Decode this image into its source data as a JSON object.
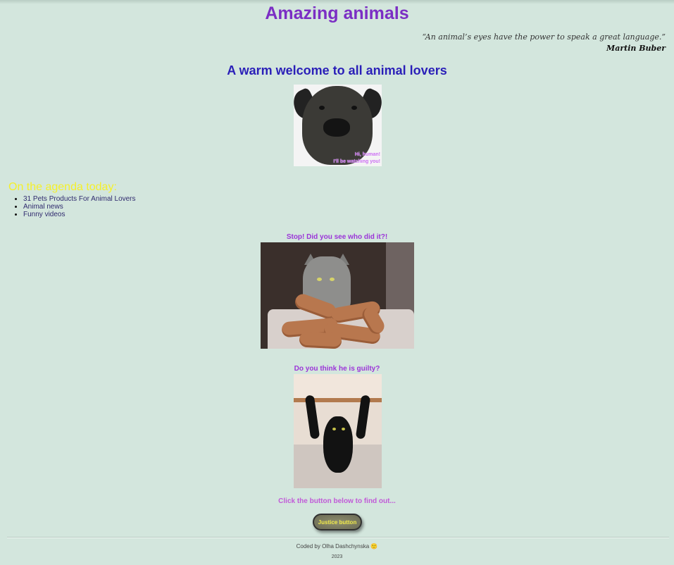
{
  "header": {
    "title": "Amazing animals",
    "quote_text": "“An animal’s eyes have the power to speak a great language.”",
    "quote_author": "Martin Buber"
  },
  "welcome": {
    "heading": "A warm welcome to all animal lovers",
    "photo_caption_line1": "Hi, human!",
    "photo_caption_line2": "I'll be watching you!"
  },
  "agenda": {
    "title": "On the agenda today:",
    "items": [
      "31 Pets Products For Animal Lovers",
      "Animal news",
      "Funny videos"
    ]
  },
  "section1": {
    "caption": "Stop! Did you see who did it?!"
  },
  "section2": {
    "caption": "Do you think he is guilty?"
  },
  "section3": {
    "caption": "Click the button below to find out..."
  },
  "button": {
    "label": "Justice button"
  },
  "footer": {
    "credit": "Coded by Olha Dashchynska 🙂",
    "year": "2023"
  },
  "colors": {
    "background": "#d3e6dd",
    "title": "#7b2ec4",
    "welcome": "#2a1fb8",
    "agenda_title": "#f5f02a",
    "caption": "#9b34d8",
    "button_text": "#f0ea4a"
  }
}
